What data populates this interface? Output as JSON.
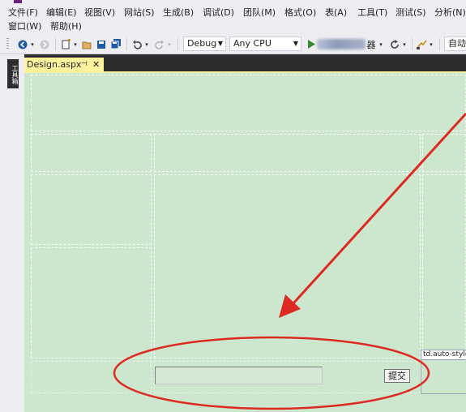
{
  "menu": {
    "row1": [
      "文件(F)",
      "编辑(E)",
      "视图(V)",
      "网站(S)",
      "生成(B)",
      "调试(D)",
      "团队(M)",
      "格式(O)",
      "表(A)",
      "工具(T)",
      "测试(S)",
      "分析(N)"
    ],
    "row2": [
      "窗口(W)",
      "帮助(H)"
    ]
  },
  "toolbar": {
    "config": "Debug",
    "platform": "Any CPU",
    "run_suffix": "器",
    "auto_label": "自动"
  },
  "leftdock": {
    "toolbox_label": "工具箱"
  },
  "document_tab": {
    "title": "Design.aspx",
    "pin": "⊣",
    "close": "✕"
  },
  "design": {
    "submit_label": "提交",
    "tag_label": "td.auto-style"
  },
  "colors": {
    "canvas": "#cde7cf",
    "tab_active": "#fff29d",
    "annotation": "#dc2b22"
  }
}
